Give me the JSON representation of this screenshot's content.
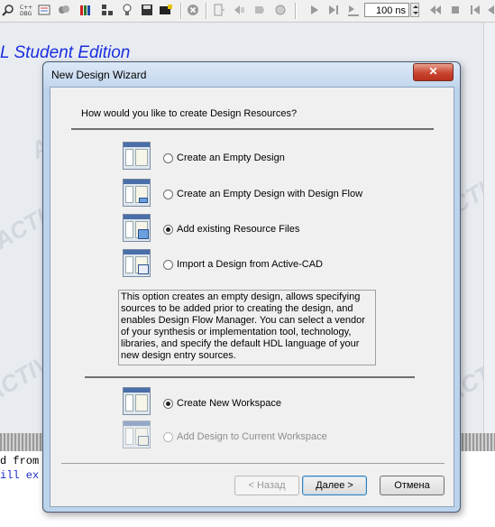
{
  "app": {
    "title_fragment": "L Student Edition",
    "watermark": "ACTIVE",
    "toolbar": {
      "icons": [
        "find-icon",
        "c-dbg-icon",
        "compile-icon",
        "library-icon",
        "books-icon",
        "hierarchy-icon",
        "bulb-icon",
        "save-icon",
        "stop-icon",
        "doc-icon",
        "run-back-icon",
        "run-step-icon",
        "run-icon",
        "play-icon",
        "step-icon",
        "step-over-icon",
        "rewind-icon",
        "fast-back-icon",
        "pause-icon",
        "end-icon"
      ],
      "sim_time": "100 ns"
    },
    "console": {
      "lines": [
        "d from",
        "ill ex"
      ]
    }
  },
  "dialog": {
    "title": "New Design Wizard",
    "close_glyph": "✕",
    "question": "How would you like to create Design Resources?",
    "design_options": [
      {
        "label": "Create an Empty Design",
        "selected": false,
        "enabled": true
      },
      {
        "label": "Create an Empty Design with Design Flow",
        "selected": false,
        "enabled": true
      },
      {
        "label": "Add existing Resource Files",
        "selected": true,
        "enabled": true
      },
      {
        "label": "Import a Design from Active-CAD",
        "selected": false,
        "enabled": true
      }
    ],
    "description": "This option creates an empty design, allows specifying sources to be added prior to creating the design, and enables Design Flow Manager. You can select a vendor of your synthesis or implementation tool, technology, libraries, and specify the default HDL language of your new design entry sources.",
    "workspace_options": [
      {
        "label": "Create New Workspace",
        "selected": true,
        "enabled": true
      },
      {
        "label": "Add Design to Current Workspace",
        "selected": false,
        "enabled": false
      }
    ],
    "buttons": {
      "back": "< Назад",
      "next": "Далее >",
      "cancel": "Отмена"
    }
  }
}
